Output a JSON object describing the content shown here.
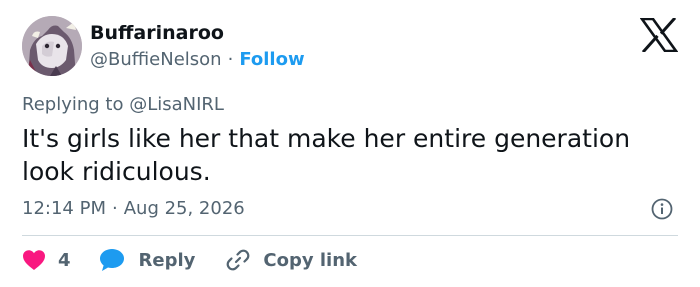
{
  "author": {
    "display_name": "Buffarinaroo",
    "handle": "@BuffieNelson",
    "separator": "·",
    "follow_label": "Follow"
  },
  "reply_context": {
    "prefix": "Replying to",
    "mention": "@LisaNIRL"
  },
  "tweet": {
    "text": "It's girls like her that make her entire generation look ridiculous.",
    "time": "12:14 PM",
    "separator": "·",
    "date": "Aug 25, 2026"
  },
  "actions": {
    "like_count": "4",
    "reply_label": "Reply",
    "copy_link_label": "Copy link"
  },
  "icons": {
    "logo": "x-logo-icon",
    "info": "info-icon",
    "like": "heart-icon",
    "reply": "speech-bubble-icon",
    "copy": "link-icon"
  },
  "colors": {
    "text": "#0f1419",
    "secondary": "#536471",
    "link": "#1d9bf0",
    "like": "#f91880",
    "reply": "#1d9bf0",
    "divider": "#cfd9de"
  }
}
